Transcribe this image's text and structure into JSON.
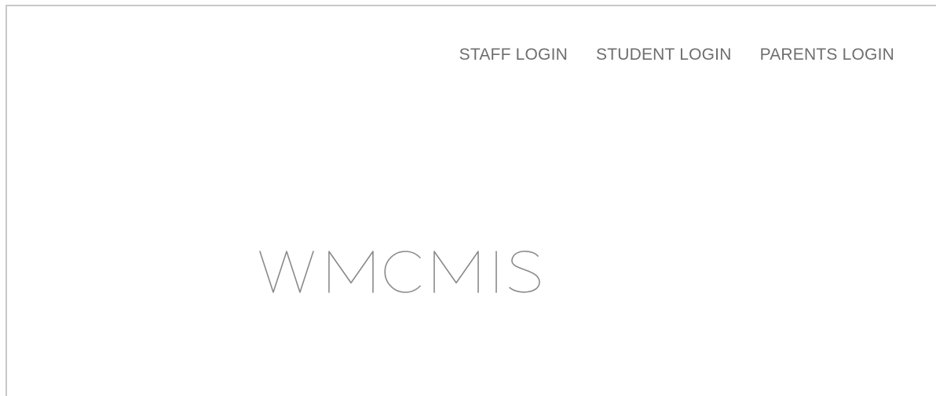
{
  "header": {
    "nav": [
      {
        "label": "STAFF LOGIN"
      },
      {
        "label": "STUDENT LOGIN"
      },
      {
        "label": "PARENTS LOGIN"
      }
    ]
  },
  "brand": {
    "logo_text": "WMCMIS",
    "color": "#8a8a8a"
  },
  "colors": {
    "nav_text": "#6e6e6e",
    "border": "#c8c8c8",
    "background": "#ffffff"
  }
}
